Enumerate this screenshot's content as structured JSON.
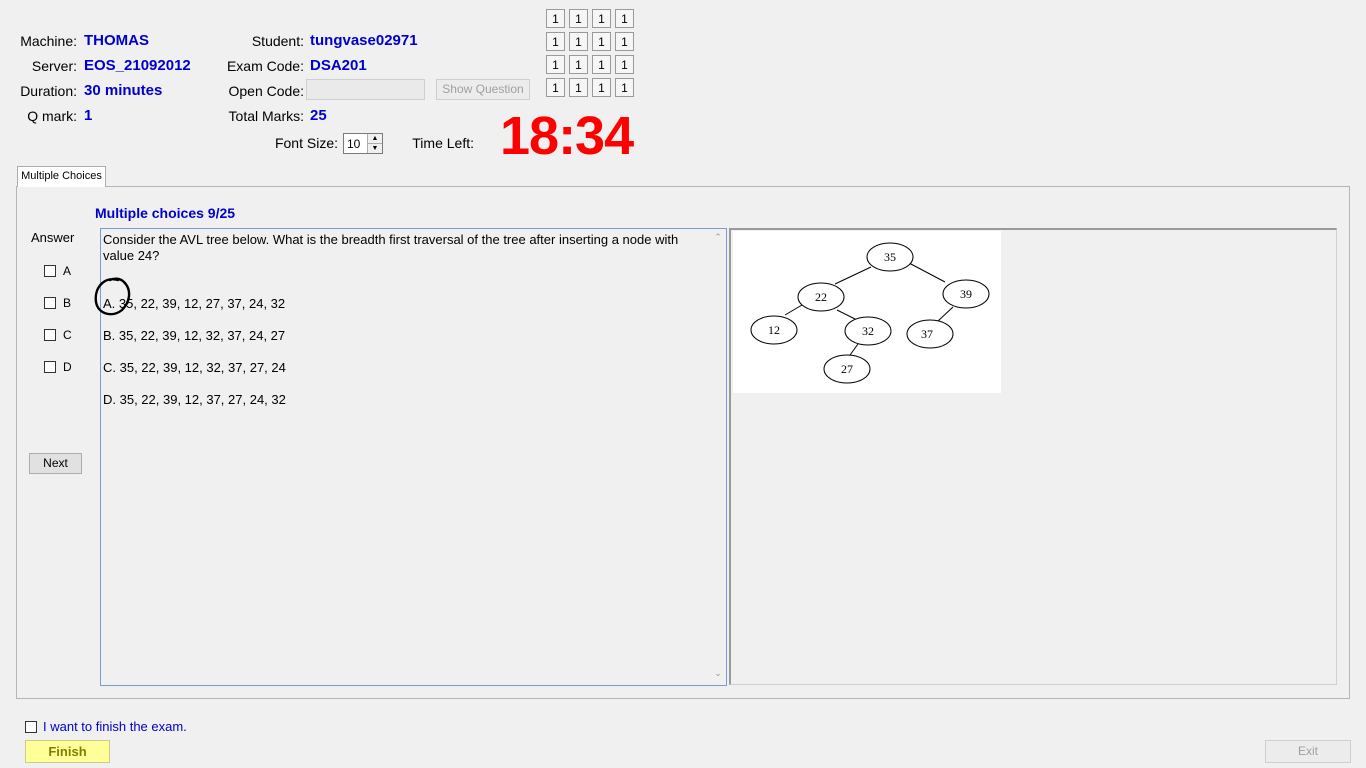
{
  "header": {
    "machine_label": "Machine:",
    "machine_value": "THOMAS",
    "server_label": "Server:",
    "server_value": "EOS_21092012",
    "duration_label": "Duration:",
    "duration_value": "30 minutes",
    "qmark_label": "Q mark:",
    "qmark_value": "1",
    "student_label": "Student:",
    "student_value": "tungvase02971",
    "examcode_label": "Exam Code:",
    "examcode_value": "DSA201",
    "opencode_label": "Open Code:",
    "opencode_value": "",
    "show_question_label": "Show Question",
    "totalmarks_label": "Total Marks:",
    "totalmarks_value": "25",
    "fontsize_label": "Font Size:",
    "fontsize_value": "10",
    "timeleft_label": "Time Left:",
    "timer_value": "18:34"
  },
  "grid": {
    "rows": [
      [
        "1",
        "1",
        "1",
        "1"
      ],
      [
        "1",
        "1",
        "1",
        "1"
      ],
      [
        "1",
        "1",
        "1",
        "1"
      ],
      [
        "1",
        "1",
        "1",
        "1"
      ]
    ]
  },
  "tab": {
    "label": "Multiple Choices"
  },
  "question": {
    "title": "Multiple choices 9/25",
    "answer_label": "Answer",
    "answer_options": [
      "A",
      "B",
      "C",
      "D"
    ],
    "next_label": "Next",
    "text": "Consider the AVL tree below. What is the breadth first traversal of the tree after inserting a node with value 24?",
    "options": [
      "A.  35, 22, 39, 12, 27, 37, 24, 32",
      "B.  35, 22, 39, 12, 32, 37, 24, 27",
      "C.  35, 22, 39, 12, 32, 37, 27, 24",
      "D.  35, 22, 39, 12, 37, 27, 24, 32"
    ]
  },
  "tree": {
    "nodes": [
      "35",
      "22",
      "39",
      "12",
      "32",
      "37",
      "27"
    ]
  },
  "footer": {
    "finish_check_label": "I want to finish the exam.",
    "finish_label": "Finish",
    "exit_label": "Exit"
  },
  "colors": {
    "value_blue": "#0000cc",
    "timer_red": "#ff0000",
    "finish_yellow": "#ffff99"
  }
}
